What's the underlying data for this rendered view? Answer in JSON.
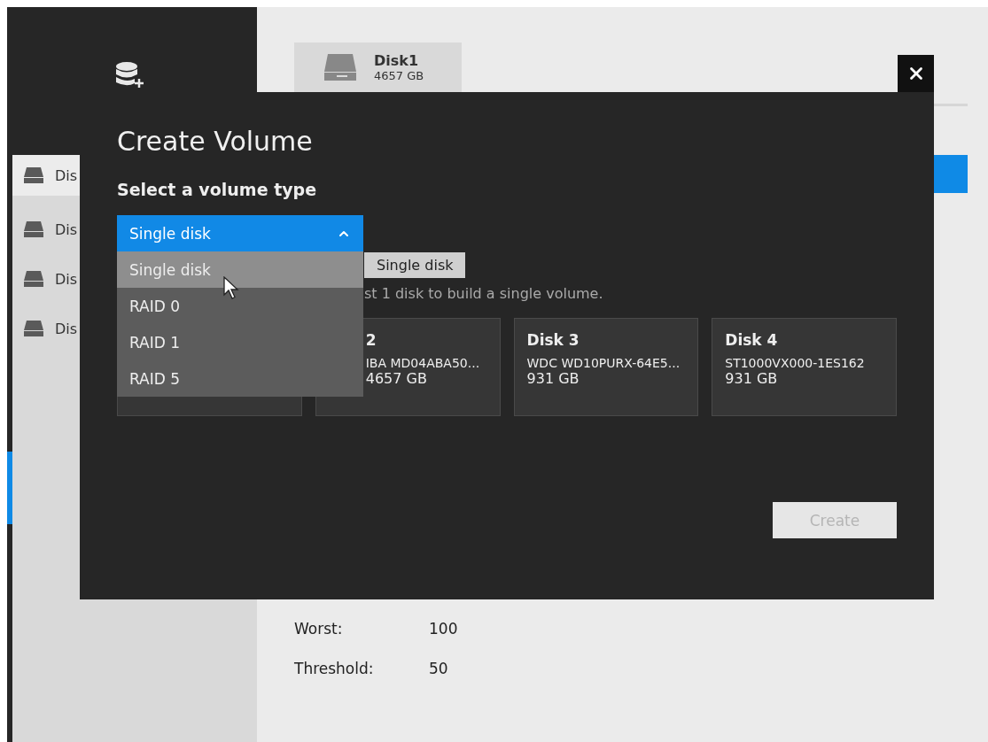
{
  "sidebar": {
    "items": [
      {
        "label": "Dis",
        "selected": true
      },
      {
        "label": "Dis",
        "selected": false
      },
      {
        "label": "Dis",
        "selected": false
      },
      {
        "label": "Dis",
        "selected": false
      }
    ]
  },
  "disk_tab": {
    "name": "Disk1",
    "size": "4657 GB"
  },
  "details": [
    {
      "label": "Worst:",
      "value": "100"
    },
    {
      "label": "Threshold:",
      "value": "50"
    }
  ],
  "dialog": {
    "title": "Create Volume",
    "type_label": "Select a volume type",
    "dropdown": {
      "value": "Single disk",
      "expanded": true,
      "options": [
        {
          "label": "Single disk",
          "selected": true
        },
        {
          "label": "RAID 0",
          "selected": false
        },
        {
          "label": "RAID 1",
          "selected": false
        },
        {
          "label": "RAID 5",
          "selected": false
        }
      ]
    },
    "tooltip": "Single disk",
    "description": "st 1 disk to build a single volume.",
    "disks": [
      {
        "kind": "hidden"
      },
      {
        "kind": "partial",
        "name": "2",
        "model": "IBA MD04ABA50...",
        "size": "4657 GB"
      },
      {
        "kind": "full",
        "name": "Disk 3",
        "model": "WDC WD10PURX-64E5...",
        "size": "931 GB"
      },
      {
        "kind": "full",
        "name": "Disk 4",
        "model": "ST1000VX000-1ES162",
        "size": "931 GB"
      }
    ],
    "create_button": {
      "label": "Create",
      "disabled": true
    }
  }
}
